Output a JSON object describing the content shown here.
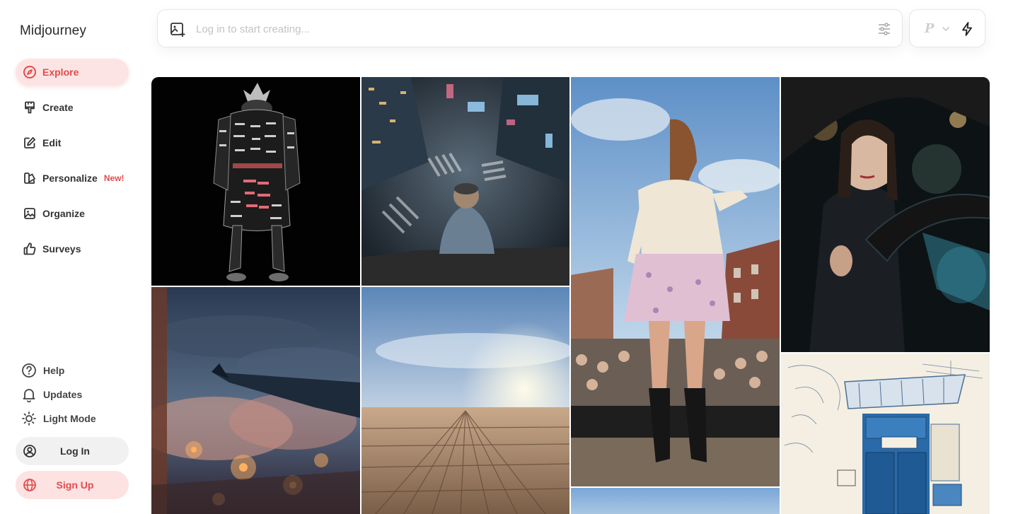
{
  "brand": "Midjourney",
  "nav": [
    {
      "label": "Explore",
      "icon": "compass-icon",
      "active": true
    },
    {
      "label": "Create",
      "icon": "brush-icon"
    },
    {
      "label": "Edit",
      "icon": "pencil-square-icon"
    },
    {
      "label": "Personalize",
      "icon": "palette-icon",
      "badge": "New!"
    },
    {
      "label": "Organize",
      "icon": "image-icon"
    },
    {
      "label": "Surveys",
      "icon": "thumbs-up-icon"
    }
  ],
  "bottom": [
    {
      "label": "Help",
      "icon": "help-circle-icon"
    },
    {
      "label": "Updates",
      "icon": "bell-icon"
    },
    {
      "label": "Light Mode",
      "icon": "sun-icon"
    }
  ],
  "auth": {
    "login": "Log In",
    "signup": "Sign Up"
  },
  "search": {
    "placeholder": "Log in to start creating..."
  },
  "version_badge": "P",
  "colors": {
    "accent": "#e54b4b",
    "accent_bg": "#fde4e4"
  },
  "gallery": [
    {
      "name": "kanji-samurai-armor"
    },
    {
      "name": "city-crossing-rooftop-view"
    },
    {
      "name": "woman-on-stage-festival"
    },
    {
      "name": "woman-driving-car-night"
    },
    {
      "name": "airplane-wing-fireworks"
    },
    {
      "name": "desert-horizon-sunset"
    },
    {
      "name": "blue-door-sketch"
    },
    {
      "name": "sky-tile"
    }
  ]
}
